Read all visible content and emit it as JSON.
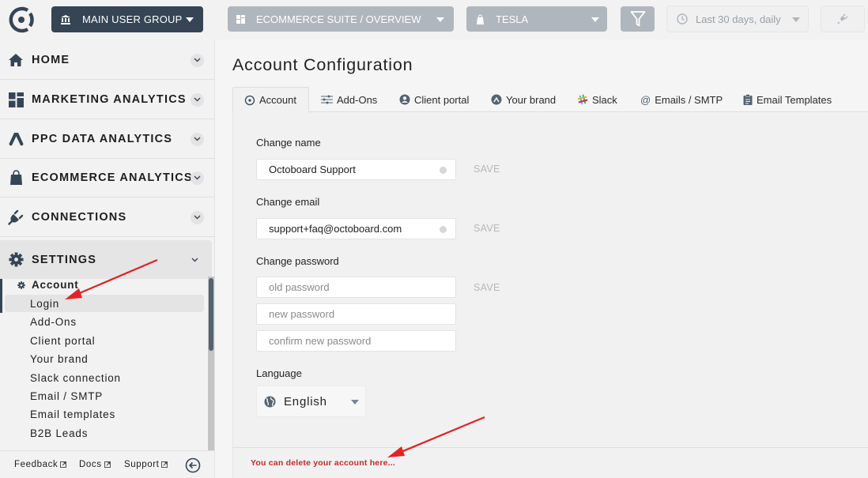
{
  "topbar": {
    "group": {
      "label": "MAIN USER GROUP",
      "icon": "bank-icon"
    },
    "suite": {
      "label": "ECOMMERCE SUITE / OVERVIEW",
      "icon": "dashboard-icon"
    },
    "client": {
      "label": "TESLA",
      "icon": "shopping-bag-icon"
    },
    "filter": {
      "icon": "filter-icon"
    },
    "date_range": {
      "label": "Last 30 days, daily",
      "icon": "clock-icon"
    },
    "connection": {
      "icon": "plug-icon"
    }
  },
  "sidebar": {
    "items": [
      {
        "label": "HOME",
        "icon": "home-icon"
      },
      {
        "label": "MARKETING ANALYTICS",
        "icon": "dashboard-icon"
      },
      {
        "label": "PPC DATA ANALYTICS",
        "icon": "ads-icon"
      },
      {
        "label": "ECOMMERCE ANALYTICS",
        "icon": "shopping-bag-icon"
      },
      {
        "label": "CONNECTIONS",
        "icon": "plug-icon"
      },
      {
        "label": "SETTINGS",
        "icon": "gear-icon"
      }
    ],
    "submenu": {
      "heading": "Account",
      "items": [
        "Login",
        "Add-Ons",
        "Client portal",
        "Your brand",
        "Slack connection",
        "Email / SMTP",
        "Email templates",
        "B2B Leads"
      ],
      "selected": "Login"
    },
    "footer": {
      "links": [
        "Feedback",
        "Docs",
        "Support"
      ]
    }
  },
  "main": {
    "title": "Account Configuration",
    "tabs": [
      {
        "label": "Account",
        "icon": "target-icon",
        "active": true
      },
      {
        "label": "Add-Ons",
        "icon": "sliders-icon"
      },
      {
        "label": "Client portal",
        "icon": "user-circle-icon"
      },
      {
        "label": "Your brand",
        "icon": "brand-icon"
      },
      {
        "label": "Slack",
        "icon": "slack-icon"
      },
      {
        "label": "Emails / SMTP",
        "icon": "at-icon"
      },
      {
        "label": "Email Templates",
        "icon": "clipboard-icon"
      }
    ],
    "form": {
      "name": {
        "label": "Change name",
        "value": "Octoboard Support",
        "save": "SAVE"
      },
      "email": {
        "label": "Change email",
        "value": "support+faq@octoboard.com",
        "save": "SAVE"
      },
      "password": {
        "label": "Change password",
        "old_placeholder": "old password",
        "new_placeholder": "new password",
        "confirm_placeholder": "confirm new password",
        "save": "SAVE"
      },
      "language": {
        "label": "Language",
        "value": "English"
      }
    },
    "delete_link": "You can delete your account here..."
  },
  "colors": {
    "brand_dark": "#354556",
    "disabled_button": "#b0b6bd",
    "danger_text": "#c62a2a",
    "annotation_arrow": "#e02424"
  }
}
